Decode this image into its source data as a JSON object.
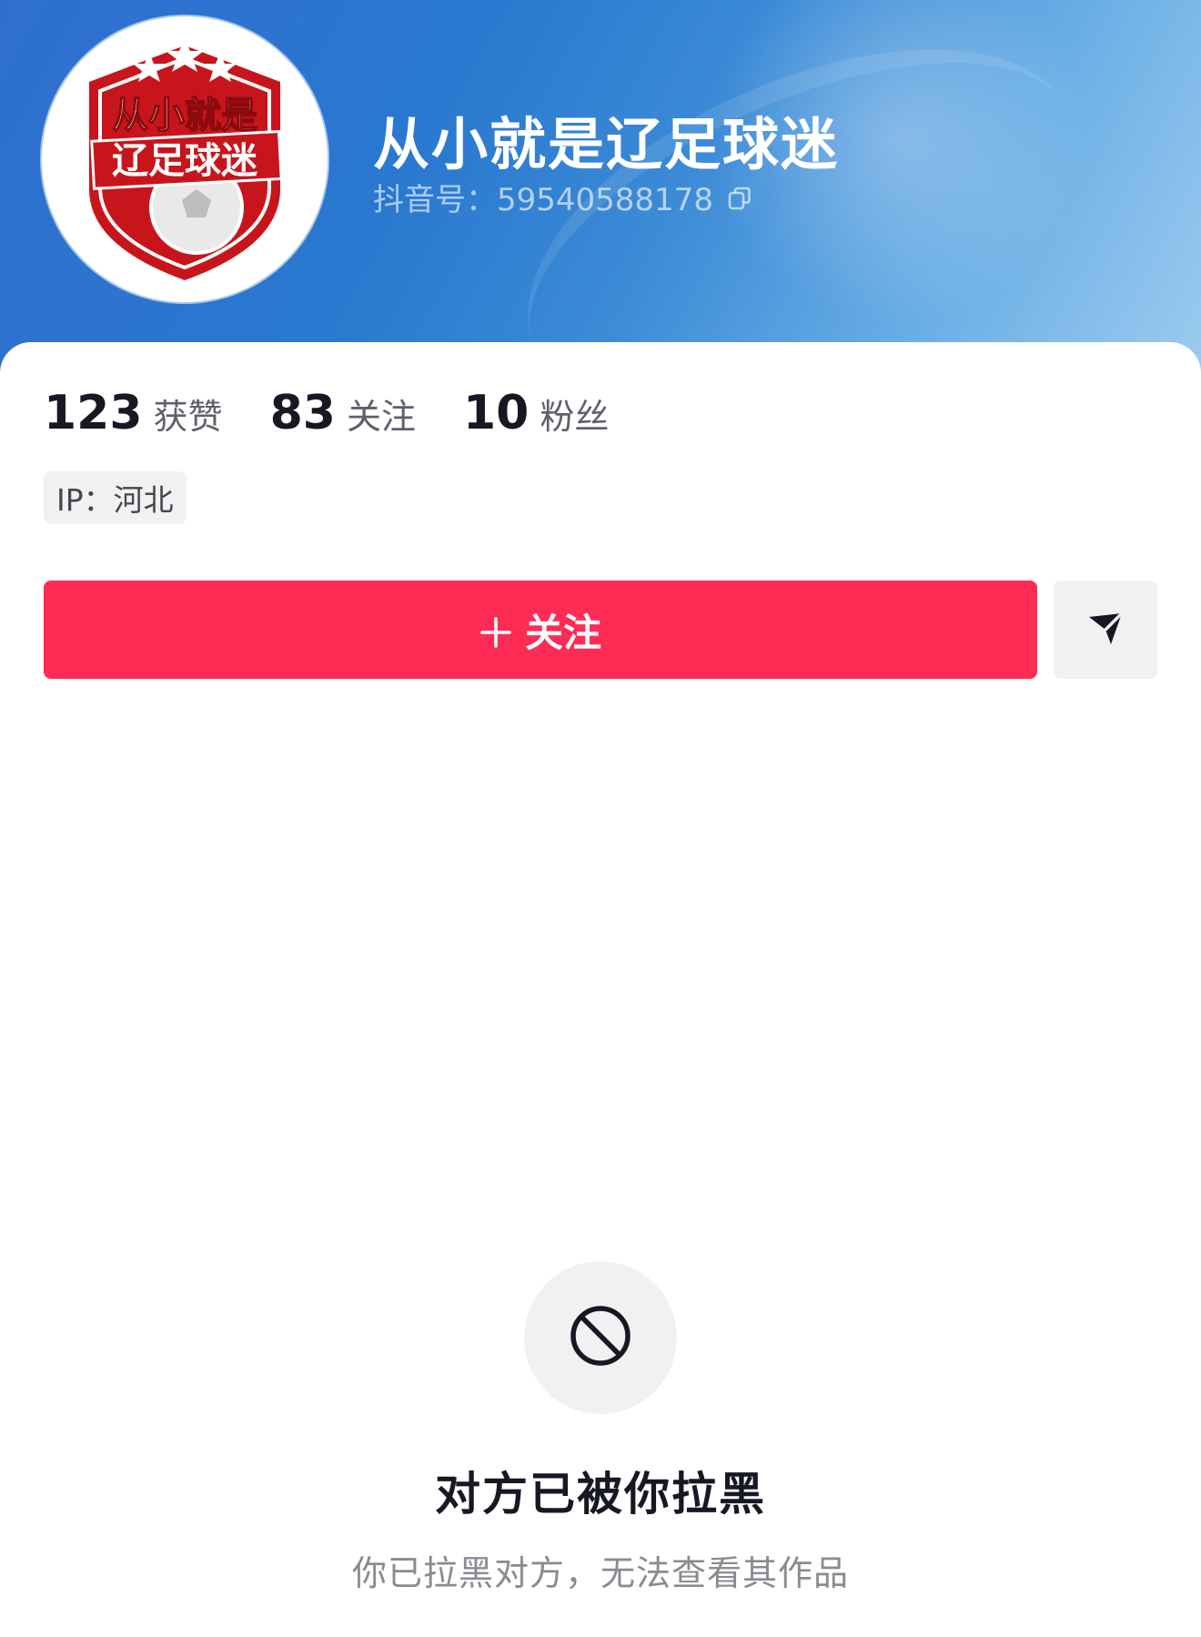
{
  "profile": {
    "username": "从小就是辽足球迷",
    "douyin_id": "抖音号：59540588178",
    "avatar_text_line1": "从小就是",
    "avatar_text_line2": "辽足球迷"
  },
  "stats": [
    {
      "value": "123",
      "label": "获赞"
    },
    {
      "value": "83",
      "label": "关注"
    },
    {
      "value": "10",
      "label": "粉丝"
    }
  ],
  "ip_location": "IP：河北",
  "actions": {
    "follow_label": "关注",
    "share_icon": "send-icon"
  },
  "blocked": {
    "icon": "block-icon",
    "title": "对方已被你拉黑",
    "subtitle": "你已拉黑对方，无法查看其作品"
  },
  "colors": {
    "accent": "#fe2c55",
    "header_blue": "#2f6fd0",
    "text_primary": "#161823",
    "text_secondary": "#8a8b91"
  }
}
